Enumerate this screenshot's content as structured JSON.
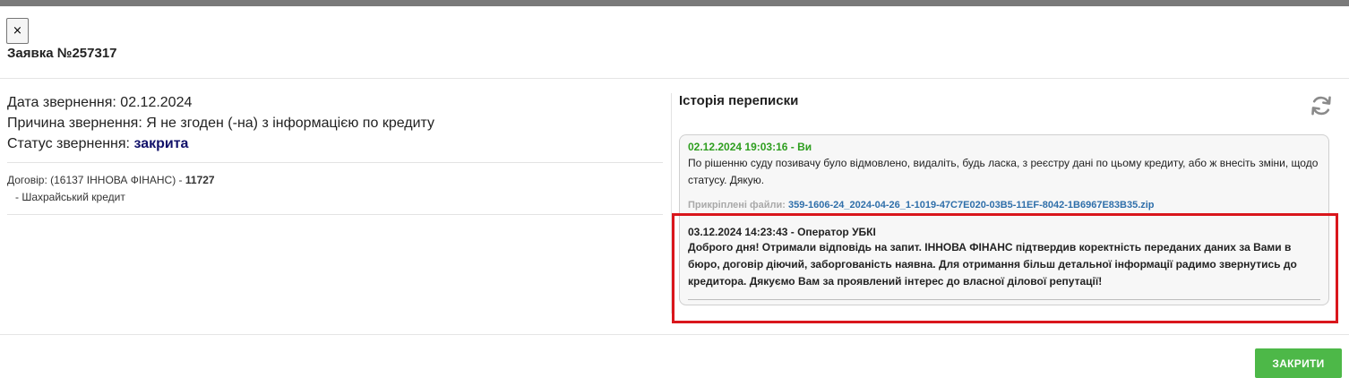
{
  "modal": {
    "close_x": "×",
    "title": "Заявка №257317",
    "close_button": "ЗАКРИТИ"
  },
  "request": {
    "date_label": "Дата звернення:",
    "date_value": "02.12.2024",
    "reason_label": "Причина звернення:",
    "reason_value": "Я не згоден (-на) з інформацією по кредиту",
    "status_label": "Статус звернення:",
    "status_value": "закрита"
  },
  "contract": {
    "prefix": "Договір: (16137 ІННОВА ФІНАНС) -",
    "number": "11727",
    "type": "- Шахрайський кредит"
  },
  "history": {
    "title": "Історія переписки",
    "refresh_icon": "refresh-icon",
    "messages": [
      {
        "header": "02.12.2024 19:03:16 - Ви",
        "body": "По рішенню суду позивачу було відмовлено, видаліть, будь ласка, з реєстру дані по цьому кредиту, або ж внесіть зміни, щодо статусу. Дякую.",
        "attach_label": "Прикріплені файли:",
        "attach_file": "359-1606-24_2024-04-26_1-1019-47C7E020-03B5-11EF-8042-1B6967E83B35.zip"
      },
      {
        "header": "03.12.2024 14:23:43 - Оператор УБКІ",
        "body": "Доброго дня! Отримали відповідь на запит. ІННОВА ФІНАНС підтвердив коректність переданих даних за Вами в бюро, договір діючий, заборгованість наявна. Для отримання більш детальної інформації радимо звернутись до кредитора. Дякуємо Вам за проявлений інтерес до власної ділової репутації!"
      }
    ]
  },
  "colors": {
    "user_header": "#2e9e1f",
    "status": "#11116a",
    "attachment_link": "#2f6faa",
    "highlight": "#d9161c",
    "close_button": "#4db848"
  }
}
